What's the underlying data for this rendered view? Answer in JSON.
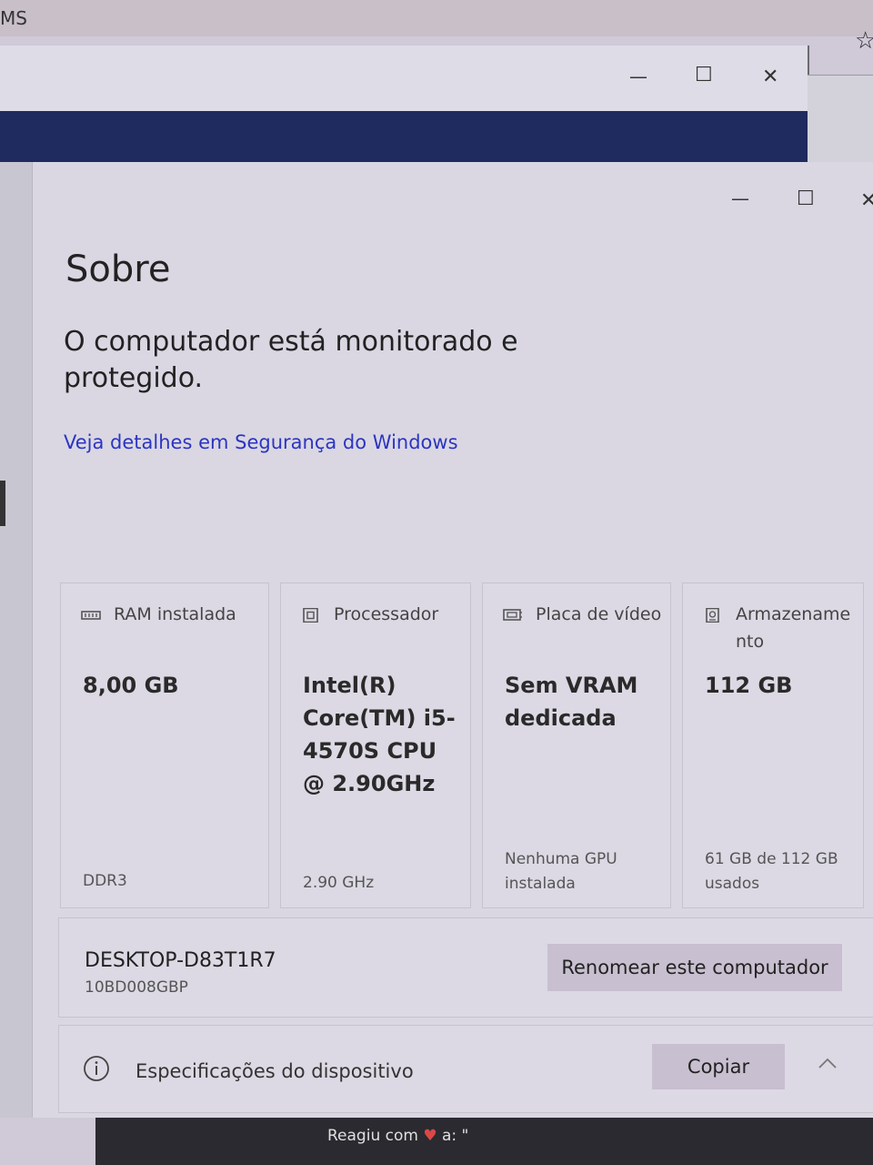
{
  "background": {
    "top_text": "MS"
  },
  "windows": {
    "back": {
      "minimize": "—",
      "maximize": "☐",
      "close": "✕"
    },
    "main": {
      "minimize": "—",
      "maximize": "☐",
      "close": "✕"
    }
  },
  "about": {
    "title": "Sobre",
    "status": "O computador está monitorado e protegido.",
    "security_link": "Veja detalhes em Segurança do Windows"
  },
  "cards": [
    {
      "label": "RAM instalada",
      "value": "8,00 GB",
      "detail": "DDR3",
      "icon": "ram-icon"
    },
    {
      "label": "Processador",
      "value": "Intel(R) Core(TM) i5-4570S CPU @ 2.90GHz",
      "detail": "2.90 GHz",
      "icon": "processor-icon"
    },
    {
      "label": "Placa de vídeo",
      "value": "Sem VRAM dedicada",
      "detail": "Nenhuma GPU instalada",
      "icon": "gpu-icon"
    },
    {
      "label": "Armazenamento",
      "value": "112 GB",
      "detail": "61 GB de 112 GB usados",
      "icon": "storage-icon"
    }
  ],
  "device": {
    "name": "DESKTOP-D83T1R7",
    "model": "10BD008GBP",
    "rename_button": "Renomear este computador"
  },
  "specs": {
    "label": "Especificações do dispositivo",
    "copy_button": "Copiar"
  },
  "taskbar": {
    "preview_text": "Reagiu com",
    "preview_suffix": "a: \""
  },
  "colors": {
    "link": "#2c35c0",
    "band": "#1f2a5e",
    "button": "#c8bfd0"
  }
}
